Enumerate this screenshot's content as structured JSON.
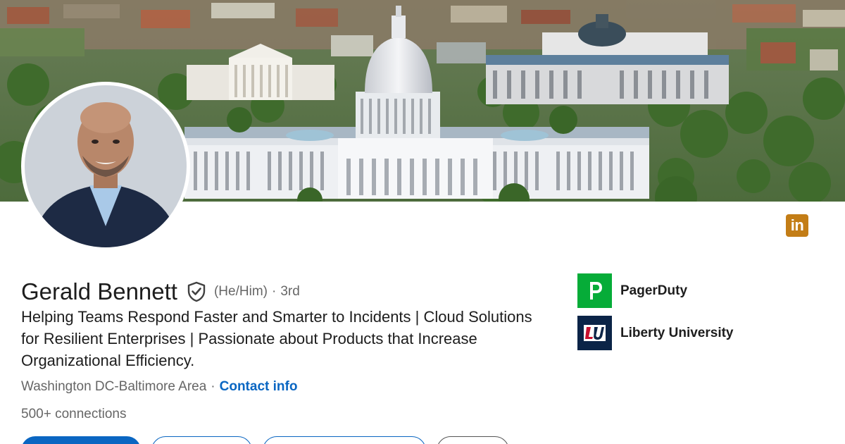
{
  "profile": {
    "name": "Gerald Bennett",
    "pronouns": "(He/Him)",
    "degree_separator": "·",
    "degree": "3rd",
    "headline": "Helping Teams Respond Faster and Smarter to Incidents | Cloud Solutions for Resilient Enterprises | Passionate about Products that Increase Organizational Efficiency.",
    "location": "Washington DC-Baltimore Area",
    "location_separator": "·",
    "contact_info_label": "Contact info",
    "connections": "500+ connections"
  },
  "experience": [
    {
      "label": "PagerDuty",
      "logo_icon": "pagerduty-logo",
      "logo_text": "P",
      "color": "#06ac38"
    },
    {
      "label": "Liberty University",
      "logo_icon": "liberty-university-logo",
      "logo_text": "LU",
      "color": "#0b2447"
    }
  ],
  "badges": {
    "linkedin_icon_text": "in",
    "linkedin_color": "#c37d16"
  },
  "colors": {
    "link_blue": "#0a66c2",
    "muted_text": "#666666",
    "primary_text": "#1d1d1d"
  },
  "icons": {
    "verified": "verified-shield-icon",
    "banner": "us-capitol-banner-image",
    "avatar": "profile-photo"
  }
}
